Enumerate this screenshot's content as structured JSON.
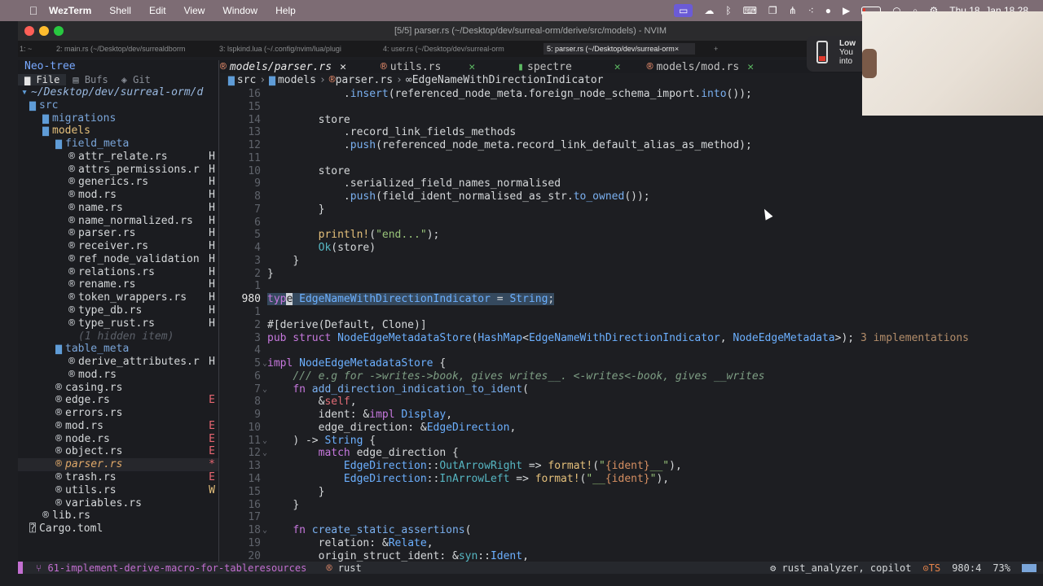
{
  "menubar": {
    "apple": "",
    "items": [
      "WezTerm",
      "Shell",
      "Edit",
      "View",
      "Window",
      "Help"
    ],
    "clock": "Thu 18. Jan 18.28"
  },
  "window": {
    "title": "[5/5] parser.rs (~/Desktop/dev/surreal-orm/derive/src/models) - NVIM",
    "tabs": [
      "1: ~",
      "2: main.rs (~/Desktop/dev/surrealdborm",
      "3: lspkind.lua (~/.config/nvim/lua/plugi",
      "4: user.rs (~/Desktop/dev/surreal-orm",
      "5: parser.rs (~/Desktop/dev/surreal-orm"
    ],
    "tab_close": "×",
    "new_tab": "+"
  },
  "neotree": {
    "title": "Neo-tree",
    "sources": [
      "File",
      "Bufs",
      "Git"
    ],
    "root": "~/Desktop/dev/surreal-orm/d",
    "rows": [
      {
        "label": "src",
        "kind": "dir-open",
        "indent": 1,
        "status": ""
      },
      {
        "label": "migrations",
        "kind": "dir",
        "indent": 2,
        "status": ""
      },
      {
        "label": "models",
        "kind": "dir-mod",
        "indent": 2,
        "status": ""
      },
      {
        "label": "field_meta",
        "kind": "dir-open",
        "indent": 3,
        "status": ""
      },
      {
        "label": "attr_relate.rs",
        "kind": "file",
        "indent": 4,
        "status": "H"
      },
      {
        "label": "attrs_permissions.r",
        "kind": "file",
        "indent": 4,
        "status": "H"
      },
      {
        "label": "generics.rs",
        "kind": "file",
        "indent": 4,
        "status": "H"
      },
      {
        "label": "mod.rs",
        "kind": "file",
        "indent": 4,
        "status": "H"
      },
      {
        "label": "name.rs",
        "kind": "file",
        "indent": 4,
        "status": "H"
      },
      {
        "label": "name_normalized.rs",
        "kind": "file",
        "indent": 4,
        "status": "H"
      },
      {
        "label": "parser.rs",
        "kind": "file",
        "indent": 4,
        "status": "H"
      },
      {
        "label": "receiver.rs",
        "kind": "file",
        "indent": 4,
        "status": "H"
      },
      {
        "label": "ref_node_validation",
        "kind": "file",
        "indent": 4,
        "status": "H"
      },
      {
        "label": "relations.rs",
        "kind": "file",
        "indent": 4,
        "status": "H"
      },
      {
        "label": "rename.rs",
        "kind": "file",
        "indent": 4,
        "status": "H"
      },
      {
        "label": "token_wrappers.rs",
        "kind": "file",
        "indent": 4,
        "status": "H"
      },
      {
        "label": "type_db.rs",
        "kind": "file",
        "indent": 4,
        "status": "H"
      },
      {
        "label": "type_rust.rs",
        "kind": "file",
        "indent": 4,
        "status": "H"
      },
      {
        "label": "(1 hidden item)",
        "kind": "hidden",
        "indent": 4,
        "status": ""
      },
      {
        "label": "table_meta",
        "kind": "dir-open",
        "indent": 3,
        "status": ""
      },
      {
        "label": "derive_attributes.r",
        "kind": "file",
        "indent": 4,
        "status": "H"
      },
      {
        "label": "mod.rs",
        "kind": "file",
        "indent": 4,
        "status": ""
      },
      {
        "label": "casing.rs",
        "kind": "file",
        "indent": 3,
        "status": ""
      },
      {
        "label": "edge.rs",
        "kind": "file",
        "indent": 3,
        "status": "E"
      },
      {
        "label": "errors.rs",
        "kind": "file",
        "indent": 3,
        "status": ""
      },
      {
        "label": "mod.rs",
        "kind": "file",
        "indent": 3,
        "status": "E"
      },
      {
        "label": "node.rs",
        "kind": "file",
        "indent": 3,
        "status": "E"
      },
      {
        "label": "object.rs",
        "kind": "file",
        "indent": 3,
        "status": "E"
      },
      {
        "label": "parser.rs",
        "kind": "file-cur",
        "indent": 3,
        "status": "*"
      },
      {
        "label": "trash.rs",
        "kind": "file",
        "indent": 3,
        "status": "E"
      },
      {
        "label": "utils.rs",
        "kind": "file",
        "indent": 3,
        "status": "W"
      },
      {
        "label": "variables.rs",
        "kind": "file",
        "indent": 3,
        "status": ""
      },
      {
        "label": "lib.rs",
        "kind": "file",
        "indent": 2,
        "status": ""
      },
      {
        "label": "Cargo.toml",
        "kind": "toml",
        "indent": 1,
        "status": ""
      }
    ]
  },
  "buffers": [
    {
      "name": "models/parser.rs",
      "active": true
    },
    {
      "name": "utils.rs",
      "active": false
    },
    {
      "name": "spectre",
      "active": false
    },
    {
      "name": "models/mod.rs",
      "active": false
    }
  ],
  "breadcrumb": [
    "src",
    "models",
    "parser.rs",
    "EdgeNameWithDirectionIndicator"
  ],
  "code": [
    {
      "ln": "16",
      "fold": "",
      "html": "            <span class=\"p\">.</span><span class=\"fn\">insert</span><span class=\"p\">(referenced_node_meta.foreign_node_schema_import.</span><span class=\"fn\">into</span><span class=\"p\">());</span>"
    },
    {
      "ln": "15",
      "fold": "",
      "html": ""
    },
    {
      "ln": "14",
      "fold": "",
      "html": "        <span class=\"p\">store</span>"
    },
    {
      "ln": "13",
      "fold": "",
      "html": "            <span class=\"p\">.record_link_fields_methods</span>"
    },
    {
      "ln": "12",
      "fold": "",
      "html": "            <span class=\"p\">.</span><span class=\"fn\">push</span><span class=\"p\">(referenced_node_meta.record_link_default_alias_as_method);</span>"
    },
    {
      "ln": "11",
      "fold": "",
      "html": ""
    },
    {
      "ln": "10",
      "fold": "",
      "html": "        <span class=\"p\">store</span>"
    },
    {
      "ln": "9",
      "fold": "",
      "html": "            <span class=\"p\">.serialized_field_names_normalised</span>"
    },
    {
      "ln": "8",
      "fold": "",
      "html": "            <span class=\"p\">.</span><span class=\"fn\">push</span><span class=\"p\">(field_ident_normalised_as_str.</span><span class=\"fn\">to_owned</span><span class=\"p\">());</span>"
    },
    {
      "ln": "7",
      "fold": "",
      "html": "        <span class=\"p\">}</span>"
    },
    {
      "ln": "6",
      "fold": "",
      "html": ""
    },
    {
      "ln": "5",
      "fold": "",
      "html": "        <span class=\"mac\">println!</span><span class=\"p\">(</span><span class=\"s\">\"end...\"</span><span class=\"p\">);</span>"
    },
    {
      "ln": "4",
      "fold": "",
      "html": "        <span class=\"t\">Ok</span><span class=\"p\">(store)</span>"
    },
    {
      "ln": "3",
      "fold": "",
      "html": "    <span class=\"p\">}</span>"
    },
    {
      "ln": "2",
      "fold": "",
      "html": "<span class=\"p\">}</span>"
    },
    {
      "ln": "1",
      "fold": "",
      "html": ""
    },
    {
      "ln": "980",
      "fold": "",
      "cur": true,
      "html": "<span class=\"hl\"><span class=\"k\">typ</span><span class=\"cursor-block\">e</span> <span class=\"ty\">EdgeNameWithDirectionIndicator</span> <span class=\"p\">=</span> <span class=\"ty\">String</span><span class=\"p\">;</span></span>"
    },
    {
      "ln": "1",
      "fold": "",
      "html": ""
    },
    {
      "ln": "2",
      "fold": "",
      "html": "<span class=\"at\">#[derive(Default, Clone)]</span>"
    },
    {
      "ln": "3",
      "fold": "",
      "html": "<span class=\"k\">pub struct</span> <span class=\"ty\">NodeEdgeMetadataStore</span><span class=\"p\">(</span><span class=\"ty\">HashMap</span><span class=\"p\">&lt;</span><span class=\"ty\">EdgeNameWithDirectionIndicator</span><span class=\"p\">, </span><span class=\"ty\">NodeEdgeMetadata</span><span class=\"p\">&gt;);</span> <span class=\"hint\">3 implementations</span>"
    },
    {
      "ln": "4",
      "fold": "",
      "html": ""
    },
    {
      "ln": "5",
      "fold": "v",
      "html": "<span class=\"k\">impl</span> <span class=\"ty\">NodeEdgeMetadataStore</span> <span class=\"p\">{</span>"
    },
    {
      "ln": "6",
      "fold": "",
      "html": "    <span class=\"co\">/// e.g for ->writes->book, gives writes__. <-writes<-book, gives __writes</span>"
    },
    {
      "ln": "7",
      "fold": "v",
      "html": "    <span class=\"k\">fn</span> <span class=\"fn\">add_direction_indication_to_ident</span><span class=\"p\">(</span>"
    },
    {
      "ln": "8",
      "fold": "",
      "html": "        <span class=\"p\">&amp;</span><span class=\"pv\">self</span><span class=\"p\">,</span>"
    },
    {
      "ln": "9",
      "fold": "",
      "html": "        <span class=\"p\">ident: &amp;</span><span class=\"k\">impl</span> <span class=\"ty\">Display</span><span class=\"p\">,</span>"
    },
    {
      "ln": "10",
      "fold": "",
      "html": "        <span class=\"p\">edge_direction: &amp;</span><span class=\"ty\">EdgeDirection</span><span class=\"p\">,</span>"
    },
    {
      "ln": "11",
      "fold": "v",
      "html": "    <span class=\"p\">) -> </span><span class=\"ty\">String</span> <span class=\"p\">{</span>"
    },
    {
      "ln": "12",
      "fold": "v",
      "html": "        <span class=\"k\">match</span> <span class=\"p\">edge_direction {</span>"
    },
    {
      "ln": "13",
      "fold": "",
      "html": "            <span class=\"ty\">EdgeDirection</span><span class=\"p\">::</span><span class=\"t\">OutArrowRight</span> <span class=\"p\">=&gt;</span> <span class=\"mac\">format!</span><span class=\"p\">(</span><span class=\"s\">\"</span><span class=\"m\">{ident}</span><span class=\"s\">__\"</span><span class=\"p\">),</span>"
    },
    {
      "ln": "14",
      "fold": "",
      "html": "            <span class=\"ty\">EdgeDirection</span><span class=\"p\">::</span><span class=\"t\">InArrowLeft</span> <span class=\"p\">=&gt;</span> <span class=\"mac\">format!</span><span class=\"p\">(</span><span class=\"s\">\"__</span><span class=\"m\">{ident}</span><span class=\"s\">\"</span><span class=\"p\">),</span>"
    },
    {
      "ln": "15",
      "fold": "",
      "html": "        <span class=\"p\">}</span>"
    },
    {
      "ln": "16",
      "fold": "",
      "html": "    <span class=\"p\">}</span>"
    },
    {
      "ln": "17",
      "fold": "",
      "html": ""
    },
    {
      "ln": "18",
      "fold": "v",
      "html": "    <span class=\"k\">fn</span> <span class=\"fn\">create_static_assertions</span><span class=\"p\">(</span>"
    },
    {
      "ln": "19",
      "fold": "",
      "html": "        <span class=\"p\">relation: &amp;</span><span class=\"ty\">Relate</span><span class=\"p\">,</span>"
    },
    {
      "ln": "20",
      "fold": "",
      "html": "        <span class=\"p\">origin_struct_ident: &amp;</span><span class=\"t\">syn</span><span class=\"p\">::</span><span class=\"ty\">Ident</span><span class=\"p\">,</span>"
    }
  ],
  "status": {
    "branch": "61-implement-derive-macro-for-tableresources",
    "filetype": "rust",
    "lsp": "rust_analyzer, copilot",
    "ts": "TS",
    "position": "980:4",
    "percent": "73%"
  },
  "notification": {
    "line1": "Low",
    "line2": "You",
    "line3": "into"
  },
  "colors": {
    "accent": "#c36fd1",
    "menubar": "#7d6c74"
  }
}
